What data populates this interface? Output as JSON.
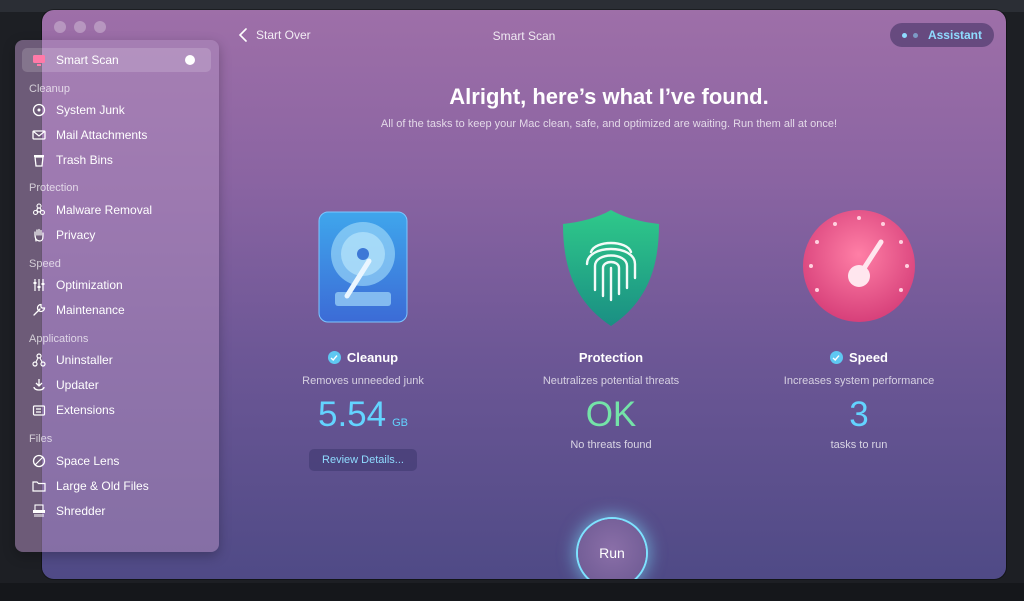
{
  "window": {
    "title": "Smart Scan",
    "back_label": "Start Over",
    "assistant_label": "Assistant"
  },
  "sidebar": {
    "active": {
      "label": "Smart Scan",
      "icon": "monitor-icon"
    },
    "sections": [
      {
        "title": "Cleanup",
        "items": [
          {
            "label": "System Junk",
            "icon": "disk-icon"
          },
          {
            "label": "Mail Attachments",
            "icon": "mail-icon"
          },
          {
            "label": "Trash Bins",
            "icon": "trash-icon"
          }
        ]
      },
      {
        "title": "Protection",
        "items": [
          {
            "label": "Malware Removal",
            "icon": "biohazard-icon"
          },
          {
            "label": "Privacy",
            "icon": "hand-icon"
          }
        ]
      },
      {
        "title": "Speed",
        "items": [
          {
            "label": "Optimization",
            "icon": "sliders-icon"
          },
          {
            "label": "Maintenance",
            "icon": "wrench-icon"
          }
        ]
      },
      {
        "title": "Applications",
        "items": [
          {
            "label": "Uninstaller",
            "icon": "uninstaller-icon"
          },
          {
            "label": "Updater",
            "icon": "updater-icon"
          },
          {
            "label": "Extensions",
            "icon": "extensions-icon"
          }
        ]
      },
      {
        "title": "Files",
        "items": [
          {
            "label": "Space Lens",
            "icon": "lens-icon"
          },
          {
            "label": "Large & Old Files",
            "icon": "folder-icon"
          },
          {
            "label": "Shredder",
            "icon": "shredder-icon"
          }
        ]
      }
    ]
  },
  "main": {
    "headline": "Alright, here’s what I’ve found.",
    "subline": "All of the tasks to keep your Mac clean, safe, and optimized are waiting. Run them all at once!",
    "cards": {
      "cleanup": {
        "title": "Cleanup",
        "desc": "Removes unneeded junk",
        "value": "5.54",
        "unit": "GB",
        "button": "Review Details...",
        "icon": "hard-drive-icon"
      },
      "protection": {
        "title": "Protection",
        "desc": "Neutralizes potential threats",
        "value": "OK",
        "sub": "No threats found",
        "icon": "fingerprint-shield-icon"
      },
      "speed": {
        "title": "Speed",
        "desc": "Increases system performance",
        "value": "3",
        "sub": "tasks to run",
        "icon": "speedometer-icon"
      }
    },
    "run_label": "Run"
  },
  "colors": {
    "accent": "#63d4ff",
    "ok": "#74e3a8",
    "check": "#5fc8f2"
  }
}
